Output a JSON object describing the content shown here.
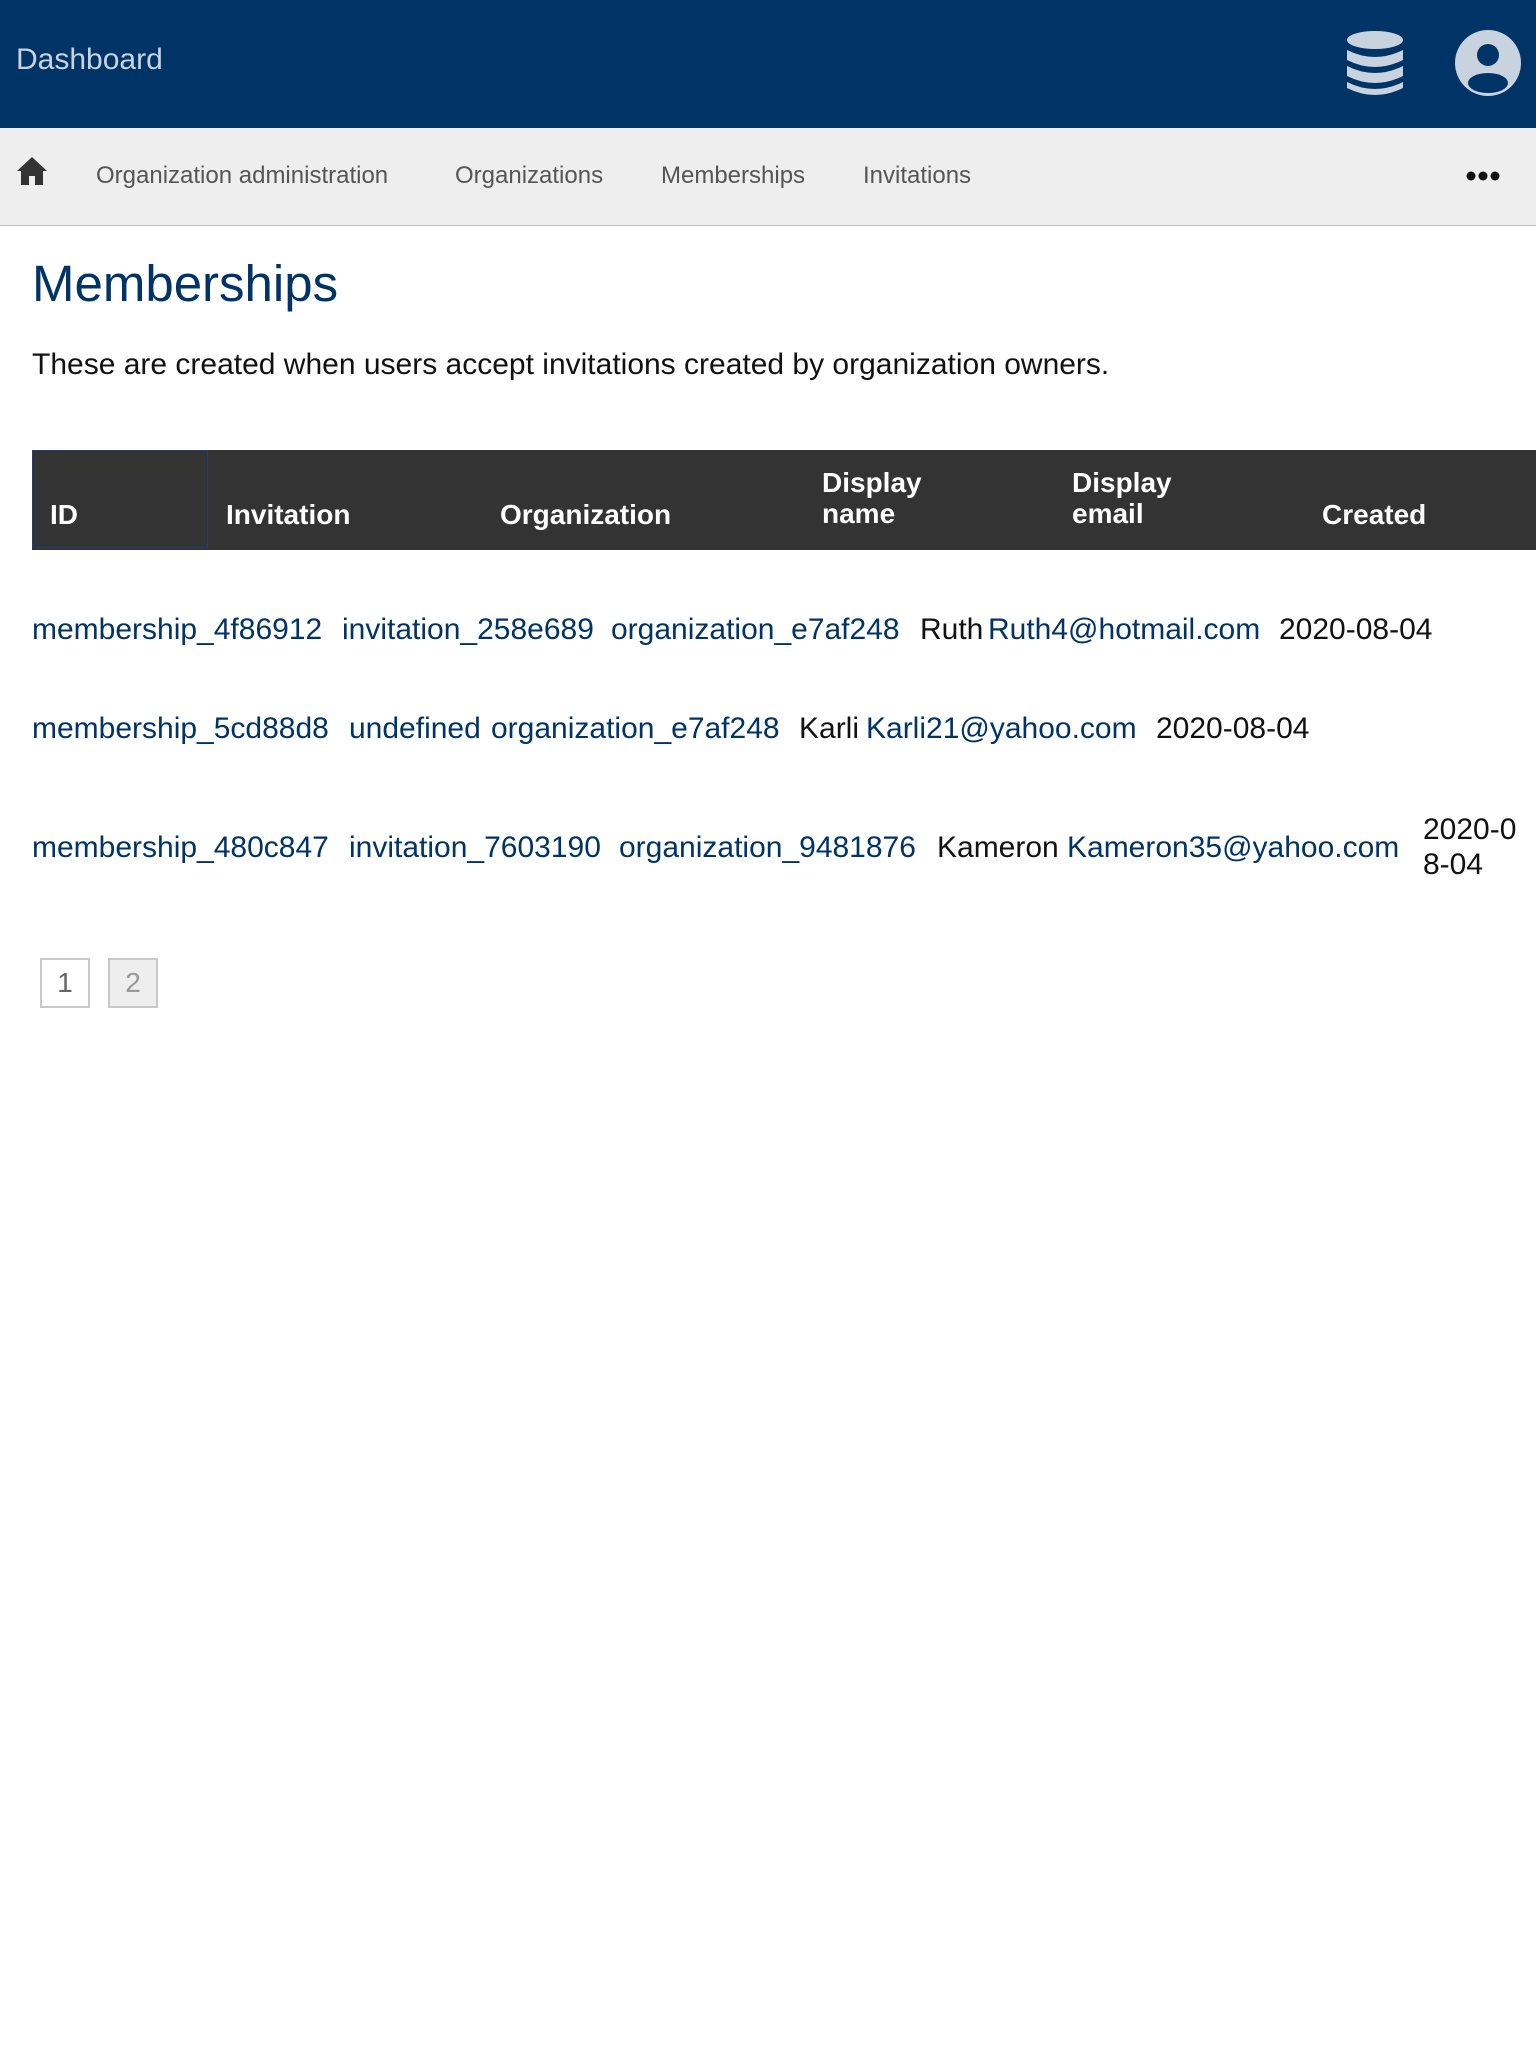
{
  "header": {
    "brand": "Dashboard",
    "icons": [
      "database-icon",
      "user-icon"
    ]
  },
  "nav": {
    "items": [
      "Organization administration",
      "Organizations",
      "Memberships",
      "Invitations"
    ],
    "icons": [
      "home-icon",
      "more-icon"
    ]
  },
  "page": {
    "title": "Memberships",
    "description": "These are created when users accept invitations created by organization owners."
  },
  "table": {
    "columns": [
      "ID",
      "Invitation",
      "Organization",
      "Display name",
      "Display email",
      "Created"
    ],
    "rows": [
      {
        "id": "membership_4f86912",
        "invitation": "invitation_258e689",
        "organization": "organization_e7af248",
        "display_name": "Ruth",
        "display_email": "Ruth4@hotmail.com",
        "created": "2020-08-04"
      },
      {
        "id": "membership_5cd88d8",
        "invitation": "undefined",
        "organization": "organization_e7af248",
        "display_name": "Karli",
        "display_email": "Karli21@yahoo.com",
        "created": "2020-08-04"
      },
      {
        "id": "membership_480c847",
        "invitation": "invitation_7603190",
        "organization": "organization_9481876",
        "display_name": "Kameron",
        "display_email": "Kameron35@yahoo.com",
        "created": "2020-08-04"
      }
    ]
  },
  "pagination": {
    "pages": [
      "1",
      "2"
    ]
  },
  "colors": {
    "primary": "#003366",
    "nav_bg": "#eeeeee",
    "table_header": "#333333"
  }
}
